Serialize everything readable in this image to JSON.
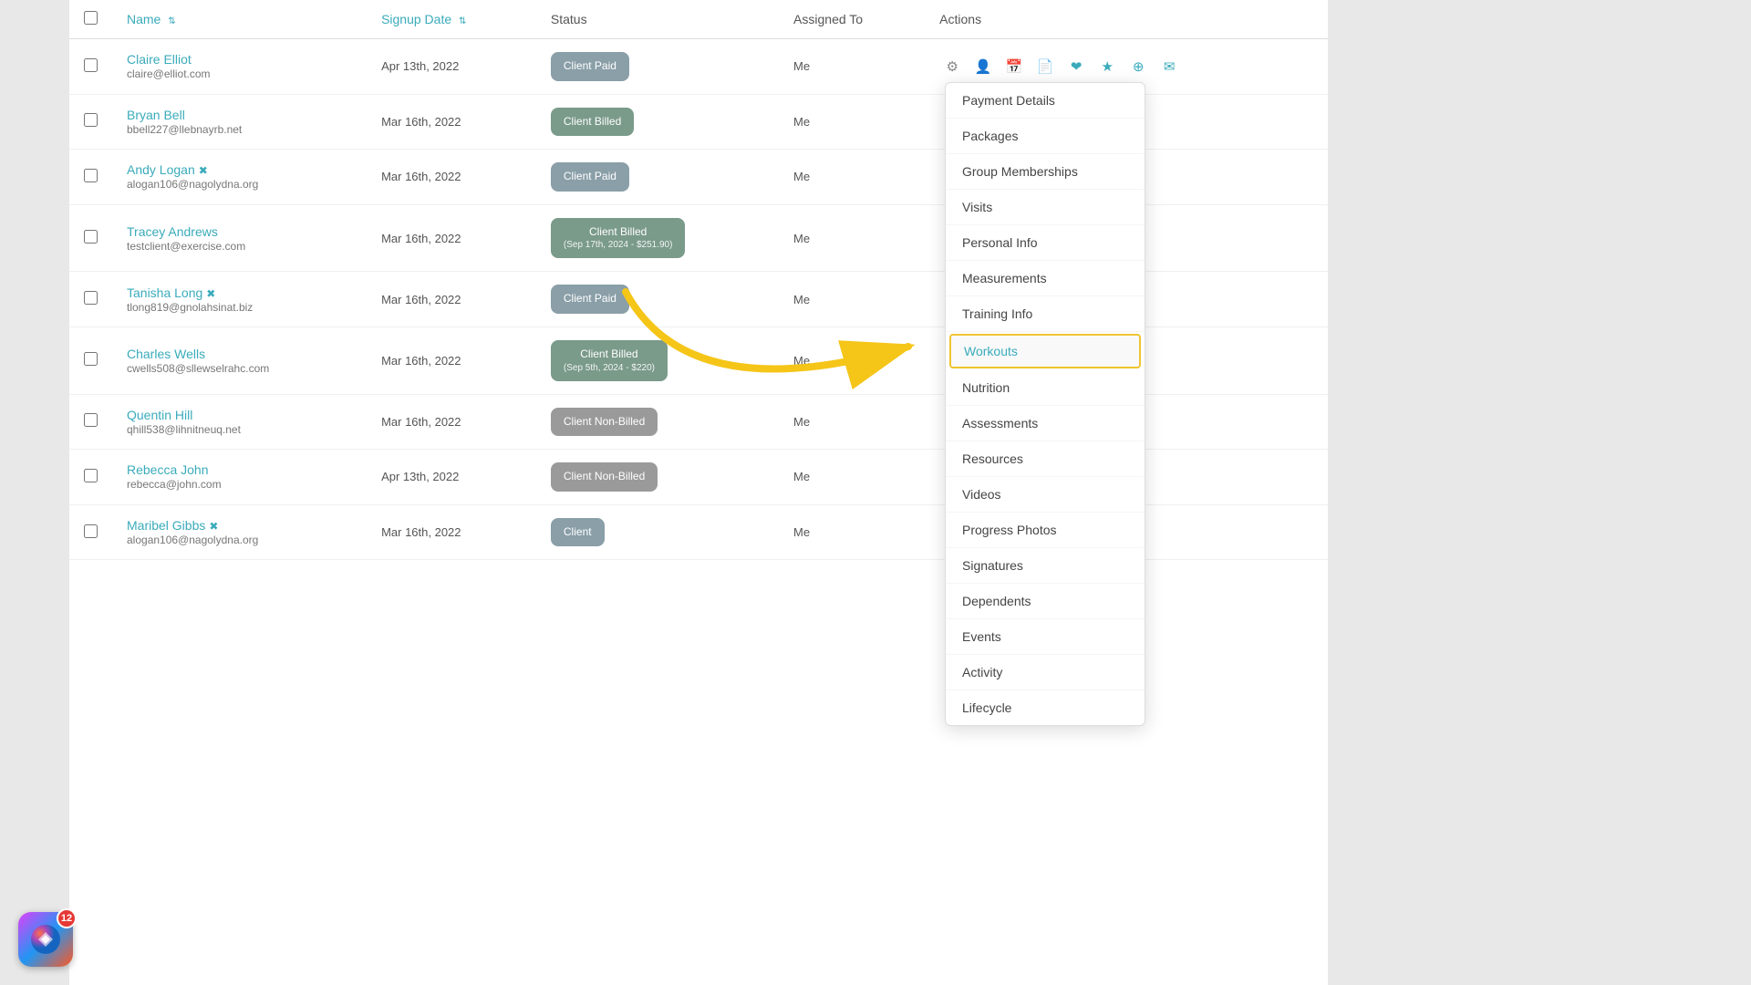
{
  "table": {
    "columns": [
      {
        "key": "checkbox",
        "label": ""
      },
      {
        "key": "name",
        "label": "Name",
        "sortable": true
      },
      {
        "key": "signup_date",
        "label": "Signup Date",
        "sortable": true
      },
      {
        "key": "status",
        "label": "Status"
      },
      {
        "key": "assigned_to",
        "label": "Assigned To"
      },
      {
        "key": "actions",
        "label": "Actions"
      }
    ],
    "rows": [
      {
        "id": 1,
        "name": "Claire Elliot",
        "email": "claire@elliot.com",
        "signup_date": "Apr 13th, 2022",
        "status": "Client Paid",
        "status_type": "paid",
        "status_sub": "",
        "assigned_to": "Me"
      },
      {
        "id": 2,
        "name": "Bryan Bell",
        "email": "bbell227@llebnayrb.net",
        "signup_date": "Mar 16th, 2022",
        "status": "Client Billed",
        "status_type": "billed",
        "status_sub": "",
        "assigned_to": "Me"
      },
      {
        "id": 3,
        "name": "Andy Logan",
        "email": "alogan106@nagolydna.org",
        "signup_date": "Mar 16th, 2022",
        "status": "Client Paid",
        "status_type": "paid",
        "status_sub": "",
        "assigned_to": "Me",
        "has_emoji": true
      },
      {
        "id": 4,
        "name": "Tracey Andrews",
        "email": "testclient@exercise.com",
        "signup_date": "Mar 16th, 2022",
        "status": "Client Billed",
        "status_type": "billed",
        "status_sub": "(Sep 17th, 2024 - $251.90)",
        "assigned_to": "Me",
        "active": true
      },
      {
        "id": 5,
        "name": "Tanisha Long",
        "email": "tlong819@gnolahsinat.biz",
        "signup_date": "Mar 16th, 2022",
        "status": "Client Paid",
        "status_type": "paid",
        "status_sub": "",
        "assigned_to": "Me",
        "has_emoji": true
      },
      {
        "id": 6,
        "name": "Charles Wells",
        "email": "cwells508@sllewselrahc.com",
        "signup_date": "Mar 16th, 2022",
        "status": "Client Billed",
        "status_type": "billed",
        "status_sub": "(Sep 5th, 2024 - $220)",
        "assigned_to": "Me"
      },
      {
        "id": 7,
        "name": "Quentin Hill",
        "email": "qhill538@lihnitneuq.net",
        "signup_date": "Mar 16th, 2022",
        "status": "Client Non-Billed",
        "status_type": "non-billed",
        "status_sub": "",
        "assigned_to": "Me"
      },
      {
        "id": 8,
        "name": "Rebecca John",
        "email": "rebecca@john.com",
        "signup_date": "Apr 13th, 2022",
        "status": "Client Non-Billed",
        "status_type": "non-billed",
        "status_sub": "",
        "assigned_to": "Me"
      },
      {
        "id": 9,
        "name": "Maribel Gibbs",
        "email": "alogan106@nagolydna.org",
        "signup_date": "Mar 16th, 2022",
        "status": "Client",
        "status_type": "paid",
        "status_sub": "",
        "assigned_to": "Me",
        "has_emoji": true,
        "partial": true
      }
    ]
  },
  "dropdown": {
    "items": [
      "Payment Details",
      "Packages",
      "Group Memberships",
      "Visits",
      "Personal Info",
      "Measurements",
      "Training Info",
      "Workouts",
      "Nutrition",
      "Assessments",
      "Resources",
      "Videos",
      "Progress Photos",
      "Signatures",
      "Dependents",
      "Events",
      "Activity",
      "Lifecycle"
    ],
    "highlighted": "Workouts"
  },
  "dock": {
    "badge": "12"
  }
}
